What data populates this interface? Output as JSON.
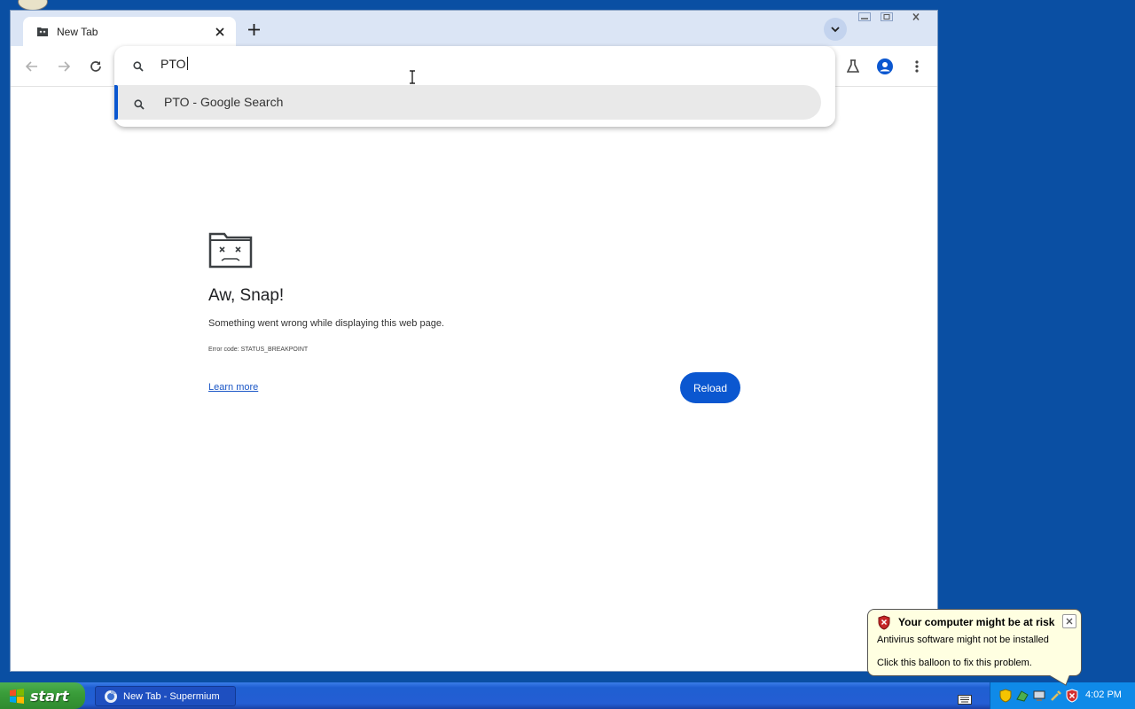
{
  "browser": {
    "tab": {
      "title": "New Tab"
    },
    "omnibox": {
      "query": "PTO",
      "suggestion": "PTO - Google Search"
    }
  },
  "error_page": {
    "title": "Aw, Snap!",
    "message": "Something went wrong while displaying this web page.",
    "error_code": "Error code: STATUS_BREAKPOINT",
    "learn_more": "Learn more",
    "reload": "Reload"
  },
  "taskbar": {
    "start_label": "start",
    "task_item": "New Tab - Supermium",
    "clock": "4:02 PM"
  },
  "balloon": {
    "title": "Your computer might be at risk",
    "line1": "Antivirus software might not be installed",
    "line2": "Click this balloon to fix this problem."
  },
  "colors": {
    "desktop": "#0a4fa3",
    "accent": "#0b57d0",
    "tabstrip": "#dbe5f5"
  }
}
